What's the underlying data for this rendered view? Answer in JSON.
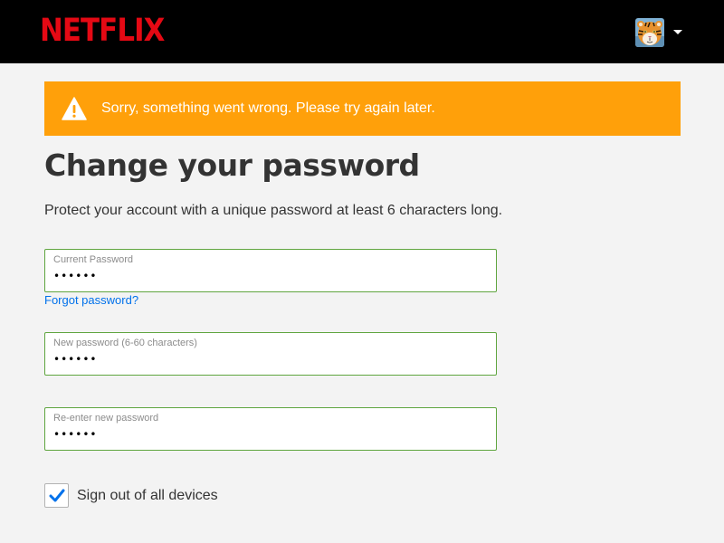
{
  "header": {
    "logo_text": "NETFLIX",
    "profile_icon": "tiger-avatar",
    "menu_icon": "caret-down-icon",
    "brand_color": "#e50914"
  },
  "alert": {
    "icon": "warning-icon",
    "message": "Sorry, something went wrong. Please try again later.",
    "color": "#ffa00a"
  },
  "page": {
    "title": "Change your password",
    "subtitle": "Protect your account with a unique password at least 6 characters long."
  },
  "form": {
    "current_password": {
      "label": "Current Password",
      "value": "••••••"
    },
    "forgot_link": "Forgot password?",
    "new_password": {
      "label": "New password (6-60 characters)",
      "value": "••••••"
    },
    "confirm_password": {
      "label": "Re-enter new password",
      "value": "••••••"
    },
    "sign_out_all": {
      "label": "Sign out of all devices",
      "checked": true
    },
    "field_border_color": "#5fa53f",
    "link_color": "#0071eb"
  }
}
